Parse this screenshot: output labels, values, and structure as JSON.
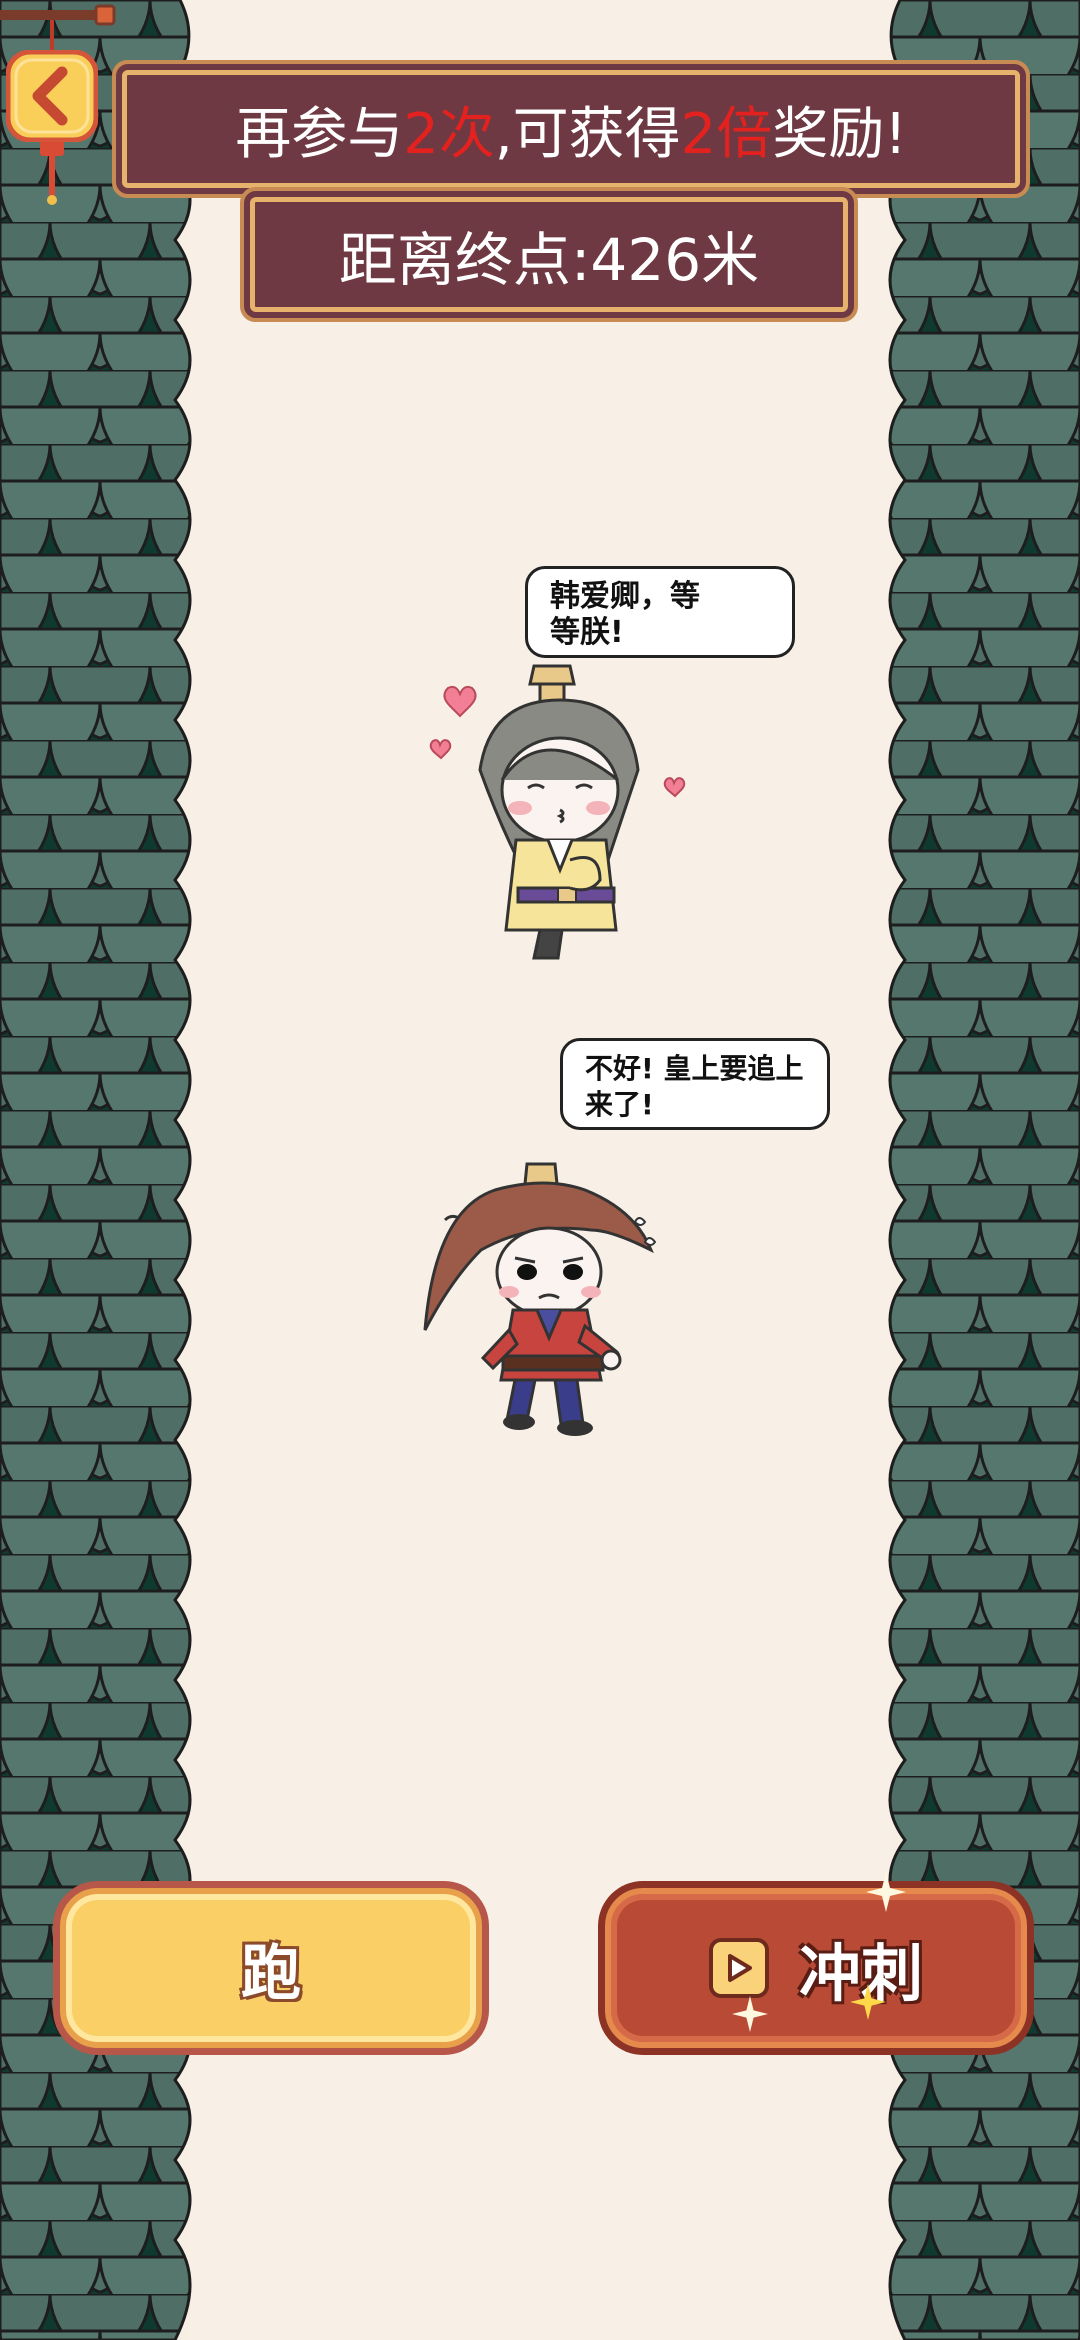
{
  "reward_banner": {
    "prefix": "再参与",
    "count": "2次",
    "middle": ",可获得",
    "multiplier": "2倍",
    "suffix": "奖励!"
  },
  "distance_banner": {
    "text": "距离终点:426米"
  },
  "speech": {
    "emperor": "韩爱卿，等等朕!",
    "emperor_line1": "韩爱卿，等",
    "emperor_line2": "等朕!",
    "minister_line1": "不好! 皇上要追上",
    "minister_line2": "来了!"
  },
  "buttons": {
    "run_label": "跑",
    "dash_label": "冲刺"
  },
  "icons": {
    "back": "back-arrow-icon",
    "play": "play-icon",
    "lantern": "lantern-icon"
  },
  "colors": {
    "banner_bg": "#6e3942",
    "banner_border": "#e7b36c",
    "highlight_red": "#e3221f",
    "run_button": "#f9cf66",
    "dash_button": "#b84a36",
    "roof_tile": "#4d6e65"
  }
}
